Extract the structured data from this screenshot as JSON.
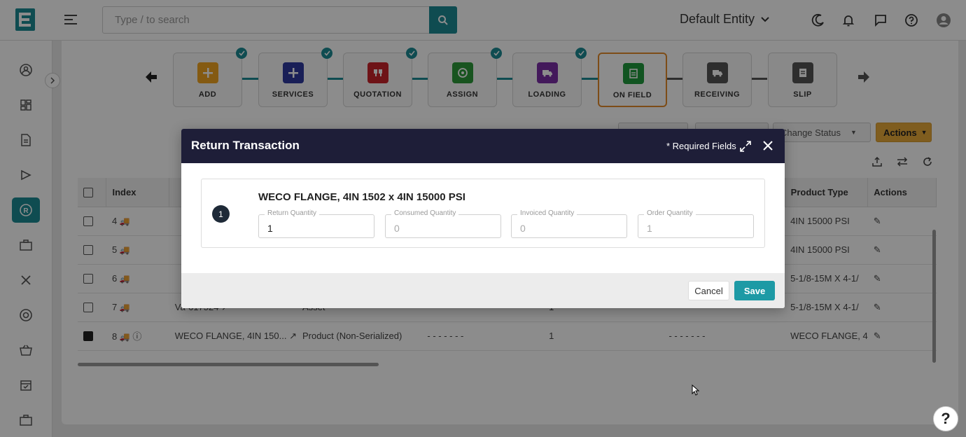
{
  "header": {
    "search_placeholder": "Type / to search",
    "entity": "Default Entity"
  },
  "workflow": {
    "steps": [
      {
        "label": "ADD",
        "color": "#f1a521",
        "done": true
      },
      {
        "label": "SERVICES",
        "color": "#2e3a9f",
        "done": true
      },
      {
        "label": "QUOTATION",
        "color": "#c9242a",
        "done": true
      },
      {
        "label": "ASSIGN",
        "color": "#2d9a3a",
        "done": true
      },
      {
        "label": "LOADING",
        "color": "#7a2ea6",
        "done": true
      },
      {
        "label": "ON FIELD",
        "color": "#1f9a3c",
        "done": false,
        "active": true
      },
      {
        "label": "RECEIVING",
        "color": "#555555",
        "done": false
      },
      {
        "label": "SLIP",
        "color": "#555555",
        "done": false
      }
    ]
  },
  "toolbar": {
    "change_status": "Change Status",
    "actions": "Actions"
  },
  "table": {
    "headers": [
      "Index",
      "Product Type",
      "Actions"
    ],
    "rows": [
      {
        "index": "4",
        "product_type": "4IN 15000 PSI"
      },
      {
        "index": "5",
        "product_type": "4IN 15000 PSI"
      },
      {
        "index": "6",
        "product_type": "5-1/8-15M X 4-1/"
      },
      {
        "index": "7",
        "name": "Va-617524",
        "kind": "Asset",
        "dash1": "- - - - - - -",
        "qty": "1",
        "dash2": "- - - - - - -",
        "product_type": "5-1/8-15M X 4-1/"
      },
      {
        "index": "8",
        "name": "WECO FLANGE, 4IN 150...",
        "kind": "Product (Non-Serialized)",
        "dash1": "- - - - - - -",
        "qty": "1",
        "dash2": "- - - - - - -",
        "product_type": "WECO FLANGE, 4"
      }
    ]
  },
  "modal": {
    "title": "Return Transaction",
    "required": "* Required Fields",
    "item_number": "1",
    "item_title": "WECO FLANGE, 4IN 1502 x 4IN 15000 PSI",
    "fields": {
      "return_qty_label": "Return Quantity",
      "return_qty": "1",
      "consumed_qty_label": "Consumed Quantity",
      "consumed_qty": "0",
      "invoiced_qty_label": "Invoiced Quantity",
      "invoiced_qty": "0",
      "order_qty_label": "Order Quantity",
      "order_qty": "1"
    },
    "cancel": "Cancel",
    "save": "Save"
  },
  "help": "?"
}
